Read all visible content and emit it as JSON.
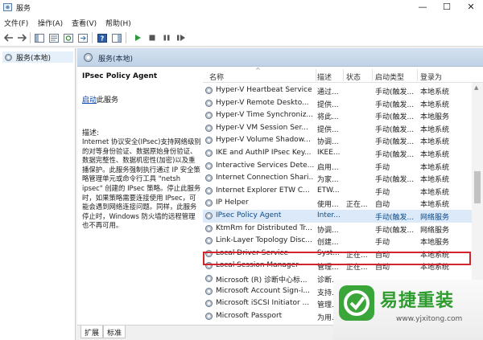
{
  "window": {
    "title": "服务",
    "minimize": "—",
    "maximize": "☐",
    "close": "✕"
  },
  "menu": {
    "items": [
      "文件(F)",
      "操作(A)",
      "查看(V)",
      "帮助(H)"
    ]
  },
  "tree": {
    "item_label": "服务(本地)"
  },
  "header": {
    "label": "服务(本地)"
  },
  "details": {
    "service_title": "IPsec Policy Agent",
    "start_link": "启动",
    "start_suffix": "此服务",
    "desc_label": "描述:",
    "desc_text": "Internet 协议安全(IPsec)支持网络级别的对等身份验证、数据原始身份验证、数据完整性、数据机密性(加密)以及重播保护。此服务强制执行通过 IP 安全策略管理单元或命令行工具 \"netsh ipsec\" 创建的 IPsec 策略。停止此服务时，如果策略需要连接使用 IPsec，可能会遇到网络连接问题。同样，此服务停止时，Windows 防火墙的远程管理也不再可用。"
  },
  "columns": {
    "name": "名称",
    "desc": "描述",
    "status": "状态",
    "startup": "启动类型",
    "logon": "登录为"
  },
  "rows": [
    {
      "name": "Hyper-V Heartbeat Service",
      "desc": "通过...",
      "status": "",
      "startup": "手动(触发...",
      "logon": "本地系统"
    },
    {
      "name": "Hyper-V Remote Deskto...",
      "desc": "提供...",
      "status": "",
      "startup": "手动(触发...",
      "logon": "本地系统"
    },
    {
      "name": "Hyper-V Time Synchroniz...",
      "desc": "将此...",
      "status": "",
      "startup": "手动(触发...",
      "logon": "本地服务"
    },
    {
      "name": "Hyper-V VM Session Ser...",
      "desc": "提供...",
      "status": "",
      "startup": "手动(触发...",
      "logon": "本地系统"
    },
    {
      "name": "Hyper-V Volume Shadow...",
      "desc": "协调...",
      "status": "",
      "startup": "手动(触发...",
      "logon": "本地系统"
    },
    {
      "name": "IKE and AuthIP IPsec Key...",
      "desc": "IKEE...",
      "status": "",
      "startup": "手动(触发...",
      "logon": "本地系统"
    },
    {
      "name": "Interactive Services Dete...",
      "desc": "启用...",
      "status": "",
      "startup": "手动",
      "logon": "本地系统"
    },
    {
      "name": "Internet Connection Shari...",
      "desc": "为家...",
      "status": "",
      "startup": "手动(触发...",
      "logon": "本地系统"
    },
    {
      "name": "Internet Explorer ETW C...",
      "desc": "ETW...",
      "status": "",
      "startup": "手动",
      "logon": "本地系统"
    },
    {
      "name": "IP Helper",
      "desc": "使用...",
      "status": "正在...",
      "startup": "自动",
      "logon": "本地系统"
    },
    {
      "name": "IPsec Policy Agent",
      "desc": "Inter...",
      "status": "",
      "startup": "手动(触发...",
      "logon": "网络服务"
    },
    {
      "name": "KtmRm for Distributed Tr...",
      "desc": "协调...",
      "status": "",
      "startup": "手动(触发...",
      "logon": "网络服务"
    },
    {
      "name": "Link-Layer Topology Disc...",
      "desc": "创建...",
      "status": "",
      "startup": "手动",
      "logon": "本地服务"
    },
    {
      "name": "Local Driver Service",
      "desc": "Syst...",
      "status": "正在...",
      "startup": "自动",
      "logon": "本地系统"
    },
    {
      "name": "Local Session Manager",
      "desc": "管理...",
      "status": "正在...",
      "startup": "自动",
      "logon": "本地系统"
    },
    {
      "name": "Microsoft (R) 诊断中心标...",
      "desc": "诊断...",
      "status": "",
      "startup": "",
      "logon": ""
    },
    {
      "name": "Microsoft Account Sign-i...",
      "desc": "支持...",
      "status": "",
      "startup": "",
      "logon": ""
    },
    {
      "name": "Microsoft iSCSI Initiator ...",
      "desc": "管理...",
      "status": "",
      "startup": "",
      "logon": ""
    },
    {
      "name": "Microsoft Passport",
      "desc": "为用...",
      "status": "",
      "startup": "",
      "logon": ""
    }
  ],
  "tabs": [
    "扩展",
    "标准"
  ],
  "watermark": {
    "title": "易捷重装",
    "url": "www.yjxitong.com"
  },
  "colors": {
    "highlight": "#d2242c",
    "selected_bg": "#dbe9f8",
    "header_bg": "#c9dbee",
    "brand_green": "#2e9b2e"
  }
}
